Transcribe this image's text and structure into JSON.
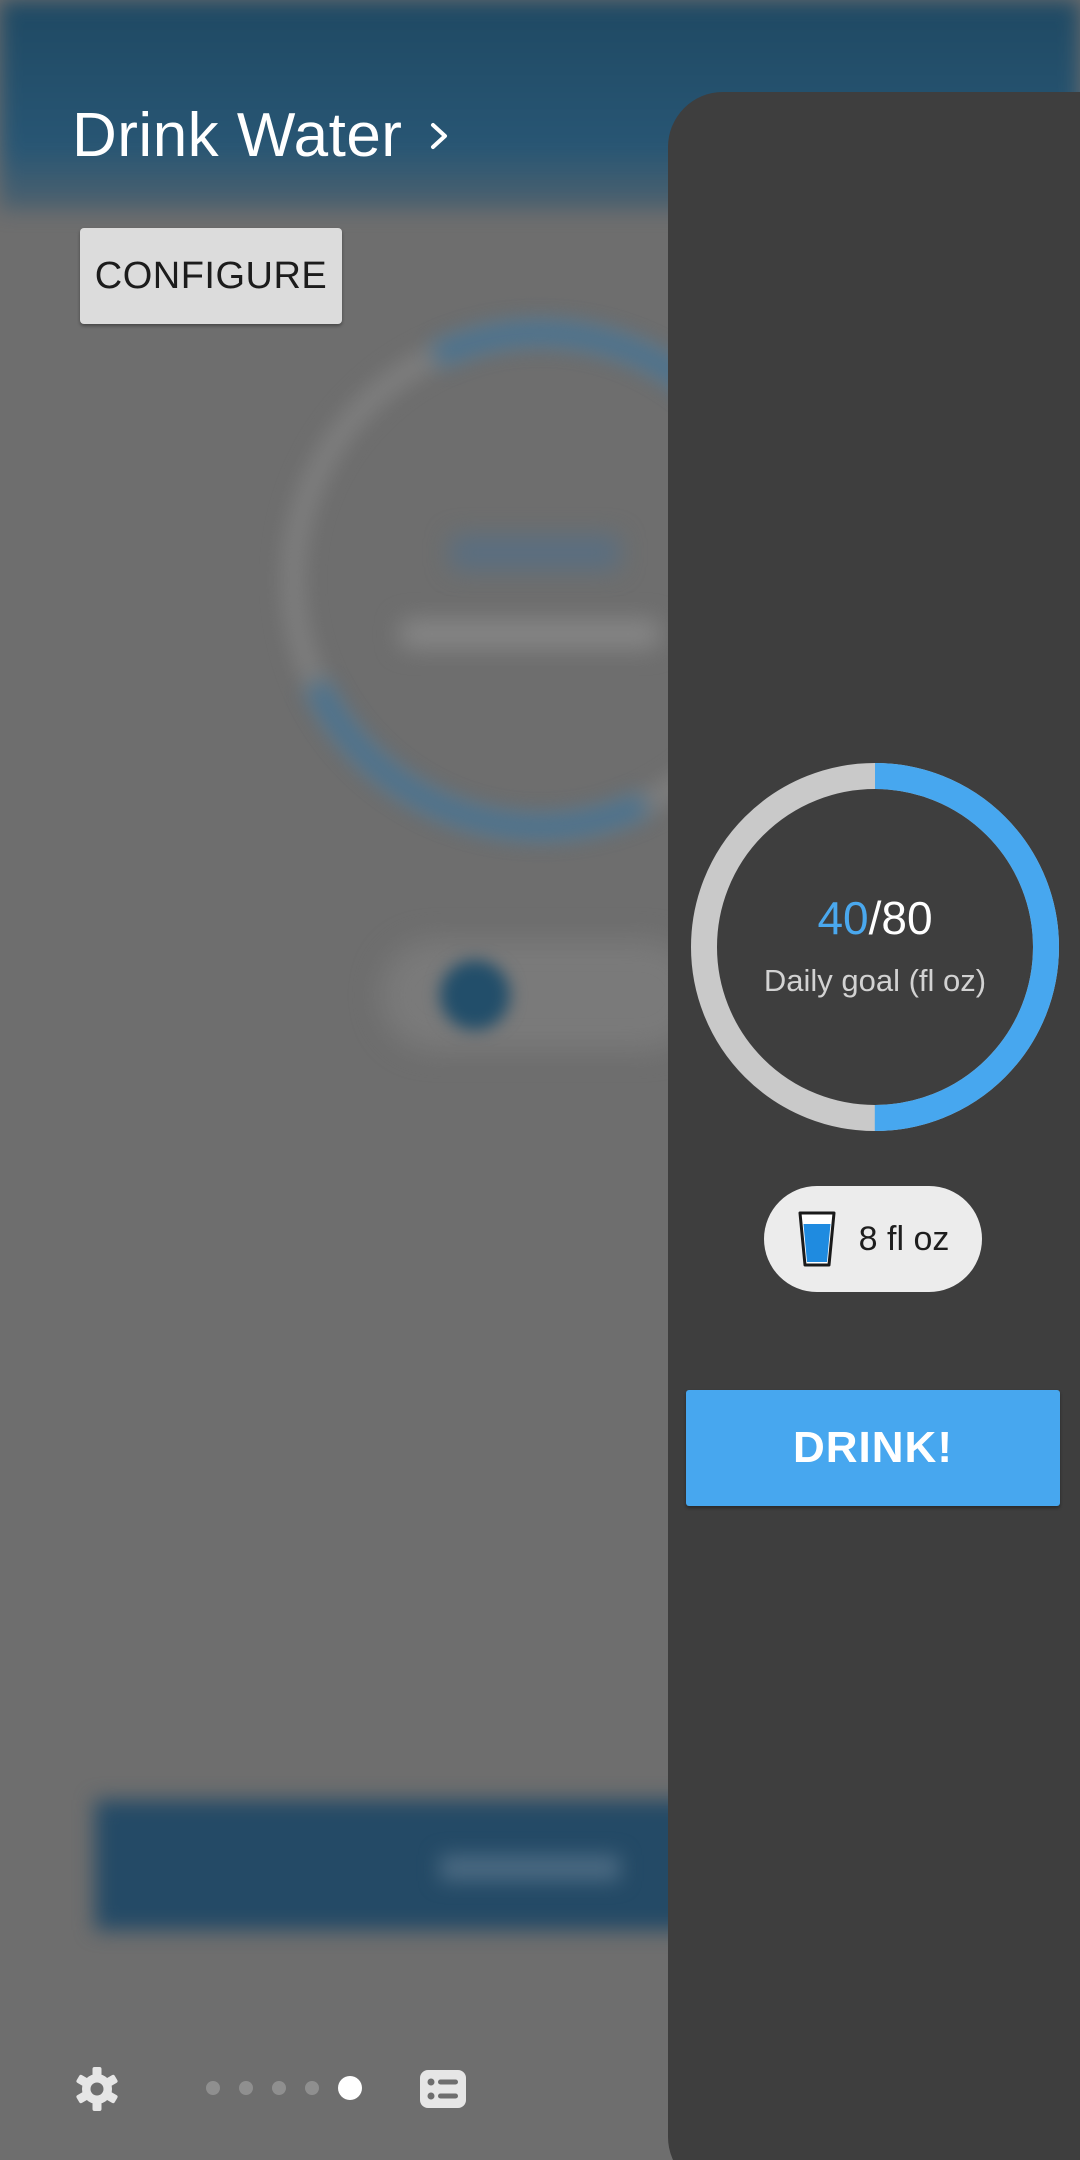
{
  "header": {
    "title": "Drink Water",
    "configure_label": "CONFIGURE"
  },
  "progress": {
    "current": "40",
    "separator": "/",
    "goal": "80",
    "fraction": 0.5,
    "label": "Daily goal (fl oz)"
  },
  "serving": {
    "label": "8 fl oz",
    "icon": "water-glass-icon"
  },
  "drink": {
    "label": "DRINK!"
  },
  "nav": {
    "page_count": 5,
    "active_index": 4,
    "left_icon": "gear-icon",
    "right_icon": "list-icon"
  },
  "colors": {
    "accent": "#47a7ef",
    "panel": "#3e3e3e",
    "ring_track": "#c9c9c9"
  }
}
